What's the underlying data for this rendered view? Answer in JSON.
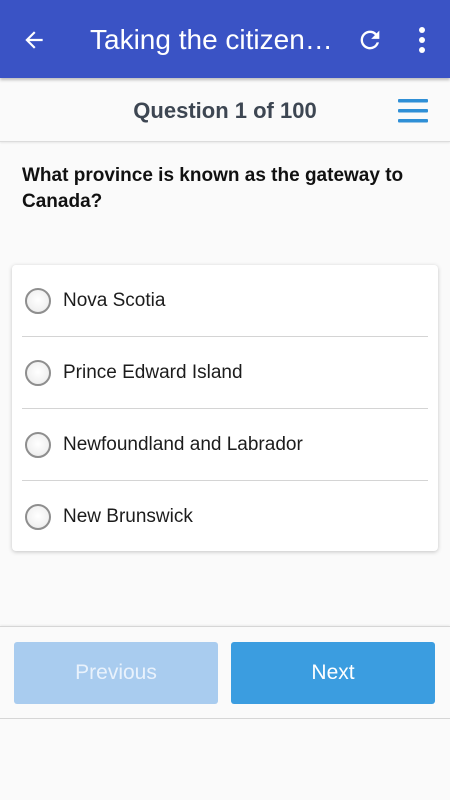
{
  "appbar": {
    "title": "Taking the citizensh…",
    "back_icon": "arrow-left-icon",
    "refresh_icon": "refresh-icon",
    "more_icon": "more-vertical-icon",
    "color": "#3a53c5"
  },
  "quiz": {
    "counter": "Question 1 of 100",
    "current": 1,
    "total": 100,
    "menu_icon": "hamburger-menu-icon",
    "menu_color": "#2f8fd6"
  },
  "question": {
    "text": "What province is known as the gateway to Canada?"
  },
  "options": [
    {
      "label": "Nova Scotia",
      "selected": false
    },
    {
      "label": "Prince Edward Island",
      "selected": false
    },
    {
      "label": "Newfoundland and Labrador",
      "selected": false
    },
    {
      "label": "New Brunswick",
      "selected": false
    }
  ],
  "nav": {
    "previous_label": "Previous",
    "previous_enabled": false,
    "next_label": "Next",
    "next_enabled": true,
    "previous_color": "#a9ccef",
    "next_color": "#3b9de0"
  }
}
